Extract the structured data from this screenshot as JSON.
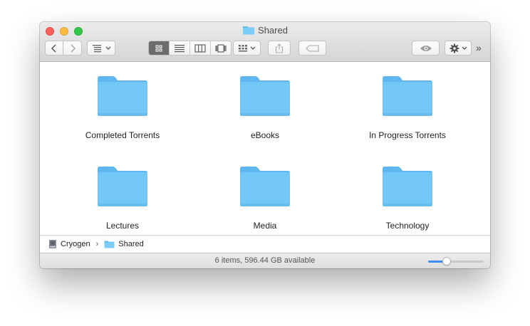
{
  "window": {
    "title": "Shared",
    "title_icon": "folder-icon"
  },
  "toolbar": {
    "back_icon": "chevron-left-icon",
    "forward_icon": "chevron-right-icon",
    "views": [
      "icon-view-icon",
      "list-view-icon",
      "column-view-icon",
      "cover-flow-icon"
    ],
    "active_view": 0,
    "overflow_label": "»"
  },
  "items": [
    {
      "label": "Completed Torrents"
    },
    {
      "label": "eBooks"
    },
    {
      "label": "In Progress Torrents"
    },
    {
      "label": "Lectures"
    },
    {
      "label": "Media"
    },
    {
      "label": "Technology"
    }
  ],
  "path": {
    "root": "Cryogen",
    "separator": "›",
    "current": "Shared"
  },
  "status": {
    "text": "6 items, 596.44 GB available",
    "icon_size_level": 0.3
  },
  "colors": {
    "folder": "#6cc3f5",
    "accent": "#3d8ef8"
  }
}
